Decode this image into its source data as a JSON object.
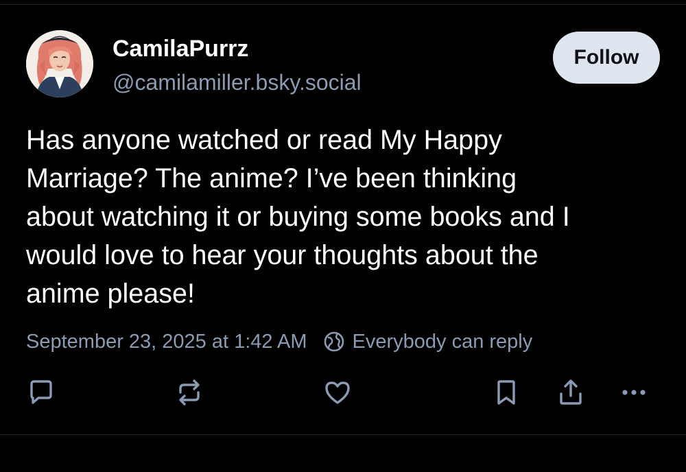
{
  "post": {
    "author": {
      "display_name": "CamilaPurrz",
      "handle": "@camilamiller.bsky.social",
      "avatar_icon": "user-avatar-illustration"
    },
    "follow_label": "Follow",
    "text": "Has anyone watched or read My Happy\nMarriage? The anime? I’ve been thinking\nabout watching it or buying some books and I\nwould love to hear your thoughts about the\nanime please!",
    "timestamp": "September 23, 2025 at 1:42 AM",
    "reply_setting": "Everybody can reply",
    "reply_setting_icon": "globe-icon"
  },
  "actions": [
    {
      "name": "reply",
      "icon": "comment-icon"
    },
    {
      "name": "repost",
      "icon": "repost-icon"
    },
    {
      "name": "like",
      "icon": "heart-icon"
    },
    {
      "name": "bookmark",
      "icon": "bookmark-icon"
    },
    {
      "name": "share",
      "icon": "share-icon"
    },
    {
      "name": "more",
      "icon": "more-icon"
    }
  ],
  "colors": {
    "background": "#000000",
    "text_primary": "#ffffff",
    "text_secondary": "#8a9bb3",
    "follow_bg": "#dfe5ee",
    "divider": "#1e2530"
  }
}
